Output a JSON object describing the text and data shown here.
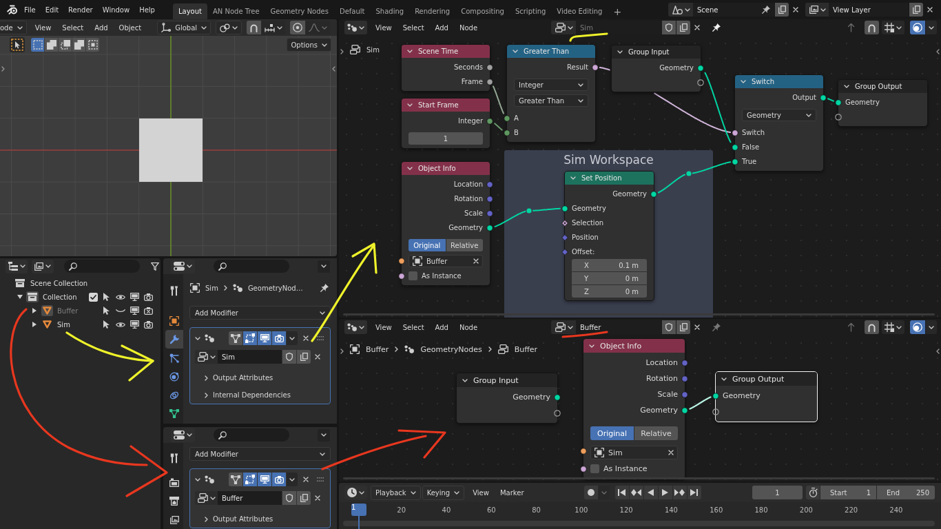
{
  "topbar": {
    "menus": [
      "File",
      "Edit",
      "Render",
      "Window",
      "Help"
    ],
    "workspaces": [
      {
        "label": "Layout",
        "selected": true
      },
      {
        "label": "AN Node Tree",
        "selected": false
      },
      {
        "label": "Geometry Nodes",
        "selected": false
      },
      {
        "label": "Default",
        "selected": false
      },
      {
        "label": "Shading",
        "selected": false
      },
      {
        "label": "Rendering",
        "selected": false
      },
      {
        "label": "Compositing",
        "selected": false
      },
      {
        "label": "Scripting",
        "selected": false
      },
      {
        "label": "Video Editing",
        "selected": false
      }
    ],
    "add_workspace": "+",
    "scene": "Scene",
    "view_layer": "View Layer"
  },
  "viewport": {
    "mode": "ode",
    "menus": [
      "View",
      "Select",
      "Add",
      "Object"
    ],
    "orientation": "Global",
    "select_modes": [
      {
        "kind": "set",
        "selected": true
      },
      {
        "kind": "extend",
        "selected": false
      },
      {
        "kind": "subtract",
        "selected": false
      },
      {
        "kind": "difference",
        "selected": false
      },
      {
        "kind": "intersect",
        "selected": false
      }
    ],
    "options": "Options"
  },
  "outliner": {
    "tree": [
      {
        "label": "Scene Collection",
        "kind": "scene_collection",
        "children": [
          {
            "label": "Collection",
            "kind": "collection",
            "expanded": true,
            "active": true,
            "checked": true,
            "hidden": false,
            "renderable": true,
            "children": [
              {
                "label": "Buffer",
                "kind": "mesh_object",
                "expanded": false,
                "active": true,
                "hidden": true,
                "renderable": false
              },
              {
                "label": "Sim",
                "kind": "mesh_object",
                "expanded": false,
                "active": false,
                "hidden": false,
                "renderable": true
              }
            ]
          }
        ]
      }
    ]
  },
  "properties": [
    {
      "tabs": [
        {
          "kind": "tool",
          "selected": false
        },
        {
          "kind": "object",
          "selected": false
        },
        {
          "kind": "modifiers",
          "selected": true
        },
        {
          "kind": "particles",
          "selected": false
        },
        {
          "kind": "physics",
          "selected": false
        },
        {
          "kind": "constraints",
          "selected": false
        },
        {
          "kind": "data",
          "selected": false
        }
      ],
      "breadcrumbs": [
        {
          "kind": "object",
          "label": "Sim"
        },
        {
          "kind": "modifier",
          "label": "GeometryNod…"
        }
      ],
      "add_modifier": "Add Modifier",
      "modifier": {
        "active": true,
        "toggles": [
          {
            "kind": "on_cage",
            "on": false
          },
          {
            "kind": "edit_mode",
            "on": true
          },
          {
            "kind": "viewport",
            "on": true
          },
          {
            "kind": "render",
            "on": true
          }
        ],
        "node_group": "Sim",
        "subpanels": [
          "Output Attributes",
          "Internal Dependencies"
        ]
      }
    },
    {
      "tabs": [
        {
          "kind": "tool",
          "selected": false
        },
        {
          "kind": "render",
          "selected": false
        },
        {
          "kind": "output",
          "selected": false
        },
        {
          "kind": "view_layer",
          "selected": false
        }
      ],
      "add_modifier": "Add Modifier",
      "modifier": {
        "active": true,
        "toggles": [
          {
            "kind": "on_cage",
            "on": false
          },
          {
            "kind": "edit_mode",
            "on": true
          },
          {
            "kind": "viewport",
            "on": true
          },
          {
            "kind": "render",
            "on": true
          }
        ],
        "node_group": "Buffer",
        "subpanels": [
          "Output Attributes"
        ]
      }
    }
  ],
  "node_editors": [
    {
      "menus": [
        "View",
        "Select",
        "Add",
        "Node"
      ],
      "node_group": "Sim",
      "pinned": true,
      "breadcrumbs": [
        {
          "kind": "node_tree",
          "label": "Sim"
        }
      ],
      "frames": [
        {
          "label": "Sim Workspace"
        }
      ],
      "nodes": [
        {
          "title": "Scene Time",
          "kind": "input",
          "selected": false,
          "rows": [
            {
              "kind": "output",
              "label": "Seconds",
              "socket": {
                "kind": "float"
              }
            },
            {
              "kind": "output",
              "label": "Frame",
              "socket": {
                "kind": "float"
              }
            }
          ]
        },
        {
          "title": "Start Frame",
          "kind": "input",
          "selected": false,
          "rows": [
            {
              "kind": "output",
              "label": "Integer",
              "socket": {
                "kind": "integer"
              }
            },
            {
              "kind": "number",
              "value": "1"
            }
          ]
        },
        {
          "title": "Object Info",
          "kind": "input",
          "selected": false,
          "rows": [
            {
              "kind": "output",
              "label": "Location",
              "socket": {
                "kind": "vector"
              }
            },
            {
              "kind": "output",
              "label": "Rotation",
              "socket": {
                "kind": "vector"
              }
            },
            {
              "kind": "output",
              "label": "Scale",
              "socket": {
                "kind": "vector"
              }
            },
            {
              "kind": "output",
              "label": "Geometry",
              "socket": {
                "kind": "geometry"
              }
            },
            {
              "kind": "toggle",
              "options": [
                {
                  "label": "Original",
                  "selected": true
                },
                {
                  "label": "Relative",
                  "selected": false
                }
              ]
            },
            {
              "kind": "object",
              "value": "Buffer",
              "socket": {
                "kind": "object"
              }
            },
            {
              "kind": "checkbox",
              "label": "As Instance",
              "checked": false,
              "socket": {
                "kind": "boolean"
              }
            }
          ]
        },
        {
          "title": "Greater Than",
          "kind": "utility",
          "selected": false,
          "rows": [
            {
              "kind": "output",
              "label": "Result",
              "socket": {
                "kind": "boolean"
              }
            },
            {
              "kind": "dropdown",
              "value": "Integer"
            },
            {
              "kind": "dropdown",
              "value": "Greater Than"
            },
            {
              "kind": "input",
              "label": "A",
              "socket": {
                "kind": "integer"
              }
            },
            {
              "kind": "input",
              "label": "B",
              "socket": {
                "kind": "integer"
              }
            }
          ]
        },
        {
          "title": "Group Input",
          "kind": "group",
          "selected": false,
          "rows": [
            {
              "kind": "output",
              "label": "Geometry",
              "socket": {
                "kind": "geometry"
              }
            },
            {
              "kind": "output",
              "socket": {
                "kind": "virtual"
              }
            }
          ]
        },
        {
          "title": "Switch",
          "kind": "utility",
          "selected": false,
          "rows": [
            {
              "kind": "output",
              "label": "Output",
              "socket": {
                "kind": "geometry"
              }
            },
            {
              "kind": "dropdown",
              "value": "Geometry"
            },
            {
              "kind": "input",
              "label": "Switch",
              "socket": {
                "kind": "boolean"
              }
            },
            {
              "kind": "input",
              "label": "False",
              "socket": {
                "kind": "geometry"
              }
            },
            {
              "kind": "input",
              "label": "True",
              "socket": {
                "kind": "geometry"
              }
            }
          ]
        },
        {
          "title": "Group Output",
          "kind": "group",
          "selected": false,
          "rows": [
            {
              "kind": "input",
              "label": "Geometry",
              "socket": {
                "kind": "geometry"
              }
            },
            {
              "kind": "input",
              "socket": {
                "kind": "virtual"
              }
            }
          ]
        },
        {
          "title": "Set Position",
          "kind": "geometry",
          "selected": false,
          "rows": [
            {
              "kind": "output",
              "label": "Geometry",
              "socket": {
                "kind": "geometry"
              }
            },
            {
              "kind": "input",
              "label": "Geometry",
              "socket": {
                "kind": "geometry"
              }
            },
            {
              "kind": "input",
              "label": "Selection",
              "socket": {
                "kind": "boolean_field"
              }
            },
            {
              "kind": "input",
              "label": "Position",
              "socket": {
                "kind": "vector_field"
              }
            },
            {
              "kind": "vector",
              "label": "Offset:",
              "socket": {
                "kind": "vector_field"
              },
              "fields": [
                {
                  "label": "X",
                  "value": "0.1 m"
                },
                {
                  "label": "Y",
                  "value": "0 m"
                },
                {
                  "label": "Z",
                  "value": "0 m"
                }
              ]
            }
          ]
        }
      ]
    },
    {
      "menus": [
        "View",
        "Select",
        "Add",
        "Node"
      ],
      "node_group": "Buffer",
      "pinned": false,
      "breadcrumbs": [
        {
          "kind": "object",
          "label": "Buffer"
        },
        {
          "kind": "modifier",
          "label": "GeometryNodes"
        },
        {
          "kind": "node_tree",
          "label": "Buffer"
        }
      ],
      "nodes": [
        {
          "title": "Group Input",
          "kind": "group",
          "selected": false,
          "rows": [
            {
              "kind": "output",
              "label": "Geometry",
              "socket": {
                "kind": "geometry"
              }
            },
            {
              "kind": "output",
              "socket": {
                "kind": "virtual"
              }
            }
          ]
        },
        {
          "title": "Object Info",
          "kind": "input",
          "selected": false,
          "rows": [
            {
              "kind": "output",
              "label": "Location",
              "socket": {
                "kind": "vector"
              }
            },
            {
              "kind": "output",
              "label": "Rotation",
              "socket": {
                "kind": "vector"
              }
            },
            {
              "kind": "output",
              "label": "Scale",
              "socket": {
                "kind": "vector"
              }
            },
            {
              "kind": "output",
              "label": "Geometry",
              "socket": {
                "kind": "geometry"
              }
            },
            {
              "kind": "toggle",
              "options": [
                {
                  "label": "Original",
                  "selected": true
                },
                {
                  "label": "Relative",
                  "selected": false
                }
              ]
            },
            {
              "kind": "object",
              "value": "Sim",
              "socket": {
                "kind": "object"
              }
            },
            {
              "kind": "checkbox",
              "label": "As Instance",
              "checked": false,
              "socket": {
                "kind": "boolean"
              }
            }
          ]
        },
        {
          "title": "Group Output",
          "kind": "group",
          "selected": true,
          "rows": [
            {
              "kind": "input",
              "label": "Geometry",
              "socket": {
                "kind": "geometry"
              }
            },
            {
              "kind": "input",
              "socket": {
                "kind": "virtual"
              }
            }
          ]
        }
      ]
    }
  ],
  "timeline": {
    "menus": [
      {
        "label": "Playback",
        "dropdown": true
      },
      {
        "label": "Keying",
        "dropdown": true
      },
      {
        "label": "View",
        "dropdown": false
      },
      {
        "label": "Marker",
        "dropdown": false
      }
    ],
    "current_frame": "1",
    "start_label": "Start",
    "start": "1",
    "end_label": "End",
    "end": "250",
    "playhead": "1",
    "ruler": [
      "20",
      "40",
      "60",
      "80",
      "100",
      "120",
      "140",
      "160",
      "180",
      "200",
      "220",
      "240"
    ]
  },
  "annotations": [
    {
      "kind": "underline",
      "color": "#eef22a"
    },
    {
      "kind": "arrow",
      "color": "#eef22a"
    },
    {
      "kind": "arrow",
      "color": "#eef22a"
    },
    {
      "kind": "arrow",
      "color": "#e8371f"
    },
    {
      "kind": "arrow",
      "color": "#e8371f"
    },
    {
      "kind": "underline",
      "color": "#e8371f"
    }
  ]
}
